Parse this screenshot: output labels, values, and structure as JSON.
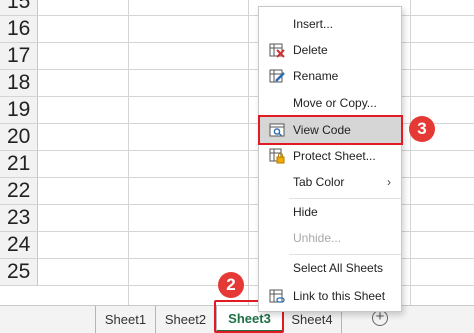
{
  "grid": {
    "row_numbers": [
      "15",
      "16",
      "17",
      "18",
      "19",
      "20",
      "21",
      "22",
      "23",
      "24",
      "25"
    ]
  },
  "sheet_tabs": {
    "tabs": [
      "Sheet1",
      "Sheet2",
      "Sheet3",
      "Sheet4"
    ],
    "active": "Sheet3",
    "add_label": "+"
  },
  "context_menu": {
    "insert": "Insert...",
    "delete": "Delete",
    "rename": "Rename",
    "move_or_copy": "Move or Copy...",
    "view_code": "View Code",
    "protect_sheet": "Protect Sheet...",
    "tab_color": "Tab Color",
    "tab_color_arrow": "›",
    "hide": "Hide",
    "unhide": "Unhide...",
    "select_all_sheets": "Select All Sheets",
    "link_to_sheet": "Link to this Sheet"
  },
  "annotations": {
    "step_tab": "2",
    "step_menu": "3",
    "highlight_color": "#e01b24",
    "badge_color": "#e53935"
  },
  "colors": {
    "active_tab_green": "#1e7145",
    "hover_gray": "#d6d6d6"
  }
}
